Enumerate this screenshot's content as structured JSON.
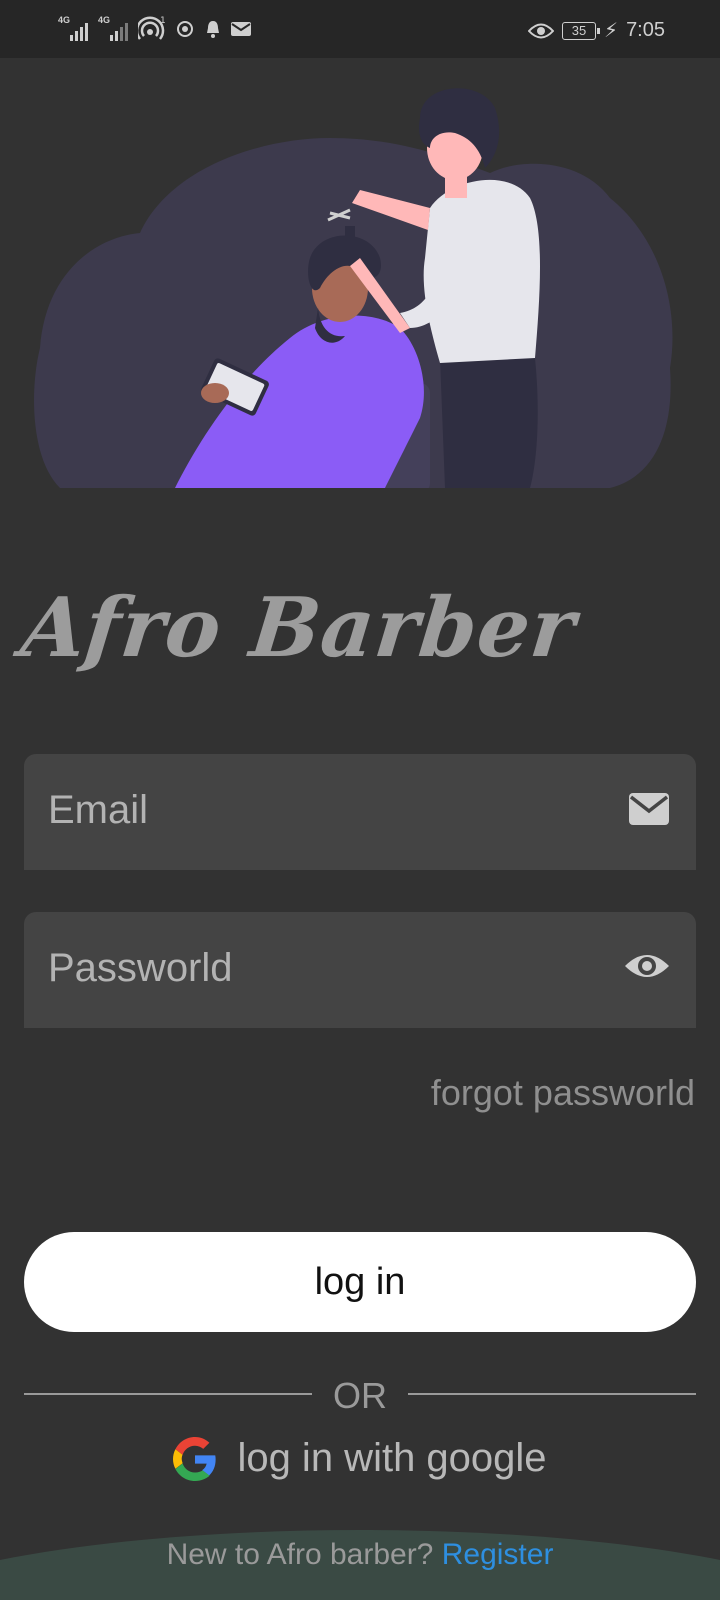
{
  "status_bar": {
    "network_1": "4G",
    "network_2": "4G",
    "hotspot_badge": "1",
    "battery": "35",
    "time": "7:05"
  },
  "app": {
    "title": "Afro Barber"
  },
  "form": {
    "email_placeholder": "Email",
    "password_placeholder": "Passworld",
    "forgot_label": "forgot passworld",
    "login_label": "log in",
    "or_label": "OR",
    "google_label": "log in with google"
  },
  "footer": {
    "prompt": "New to Afro barber?",
    "register_label": "Register"
  },
  "colors": {
    "background": "#323232",
    "field": "#444444",
    "accent_purple": "#8b5cf6",
    "link_blue": "#2e8fe0"
  }
}
